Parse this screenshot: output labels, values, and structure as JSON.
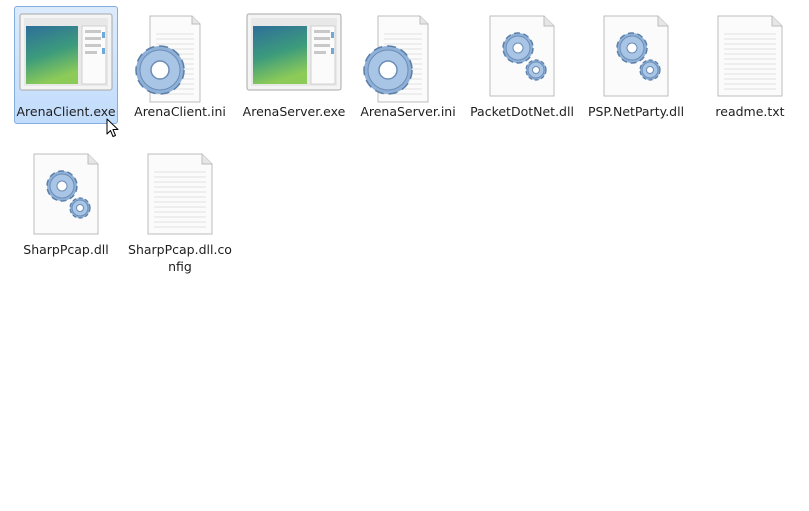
{
  "files": [
    {
      "label": "ArenaClient.exe",
      "icon": "application-window-icon",
      "selected": true
    },
    {
      "label": "ArenaClient.ini",
      "icon": "settings-gear-icon",
      "selected": false
    },
    {
      "label": "ArenaServer.exe",
      "icon": "application-window-icon",
      "selected": false
    },
    {
      "label": "ArenaServer.ini",
      "icon": "settings-gear-icon",
      "selected": false
    },
    {
      "label": "PacketDotNet.dll",
      "icon": "dll-gears-icon",
      "selected": false
    },
    {
      "label": "PSP.NetParty.dll",
      "icon": "dll-gears-icon",
      "selected": false
    },
    {
      "label": "readme.txt",
      "icon": "text-document-icon",
      "selected": false
    },
    {
      "label": "SharpPcap.dll",
      "icon": "dll-gears-icon",
      "selected": false
    },
    {
      "label": "SharpPcap.dll.config",
      "icon": "text-document-icon",
      "selected": false
    }
  ],
  "colors": {
    "selection_border": "#84acdd",
    "selection_fill": "#c9e0fc",
    "gear_blue": "#8fb1d8",
    "app_window_green": "#3f9e78"
  }
}
